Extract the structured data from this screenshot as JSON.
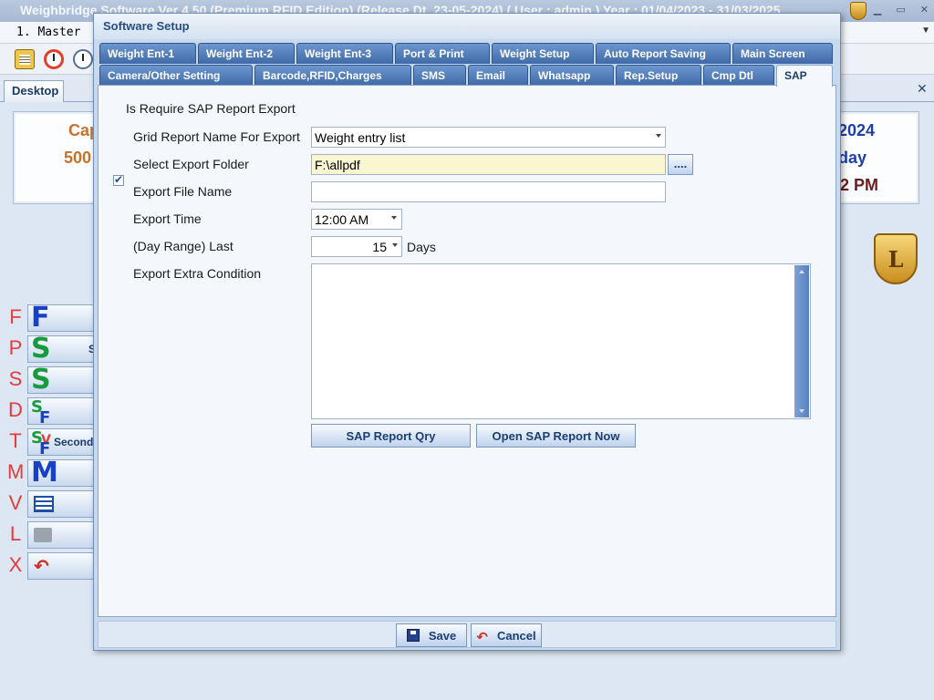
{
  "app": {
    "title": "Weighbridge Software Ver 4.50 (Premium RFID Edition) (Release Dt. 23-05-2024)  ( User : admin ) Year : 01/04/2023 - 31/03/2025",
    "window_controls": [
      "minimize",
      "restore",
      "close"
    ],
    "menu": {
      "first_item": "1. Master"
    },
    "toolbar": {
      "icons": [
        "notes-icon",
        "alarm-clock-icon",
        "clock-icon"
      ]
    }
  },
  "desktop": {
    "tab_label": "Desktop",
    "left_info_lines": [
      "Cap",
      "500"
    ],
    "right_info_lines": [
      "2024",
      "day",
      "2 PM"
    ],
    "badge_letter": "L",
    "shortcuts": [
      {
        "key": "F",
        "glyph": "F",
        "caption": "",
        "color": "#1740c4"
      },
      {
        "key": "P",
        "glyph": "S",
        "caption": "S",
        "color": "#1a9a3e"
      },
      {
        "key": "S",
        "glyph": "S",
        "caption": "",
        "color": "#1a9a3e"
      },
      {
        "key": "D",
        "glyph": "S",
        "caption": "",
        "color": "#1a9a3e"
      },
      {
        "key": "T",
        "glyph": "S",
        "caption": "Second",
        "color": "#1a9a3e"
      },
      {
        "key": "M",
        "glyph": "M",
        "caption": "",
        "color": "#1740c4"
      },
      {
        "key": "V",
        "glyph": "",
        "caption": "",
        "color": "#1d4fa6"
      },
      {
        "key": "L",
        "glyph": "",
        "caption": "",
        "color": "#8d96a3"
      },
      {
        "key": "X",
        "glyph": "",
        "caption": "",
        "color": "#cf2e22"
      }
    ]
  },
  "dialog": {
    "title": "Software Setup",
    "tabs_row1": [
      "Weight Ent-1",
      "Weight Ent-2",
      "Weight Ent-3",
      "Port & Print",
      "Weight Setup",
      "Auto Report Saving",
      "Main Screen"
    ],
    "tabs_row2": [
      "Camera/Other Setting",
      "Barcode,RFID,Charges",
      "SMS",
      "Email",
      "Whatsapp",
      "Rep.Setup",
      "Cmp Dtl",
      "SAP"
    ],
    "active_tab": "SAP",
    "sap": {
      "require_export_label": "Is Require SAP Report Export",
      "require_export_checked": true,
      "grid_report_label": "Grid Report Name For Export",
      "grid_report_value": "Weight entry list",
      "export_folder_label": "Select Export Folder",
      "export_folder_value": "F:\\allpdf",
      "browse_label": "....",
      "file_name_label": "Export File Name",
      "file_name_value": "",
      "export_time_label": "Export Time",
      "export_time_value": "12:00 AM",
      "day_range_label": "(Day Range) Last",
      "day_range_value": "15",
      "day_range_unit": "Days",
      "extra_condition_label": "Export Extra Condition",
      "extra_condition_value": "",
      "report_qry_label": "SAP Report Qry",
      "open_report_label": "Open SAP Report Now"
    },
    "footer": {
      "save_label": "Save",
      "cancel_label": "Cancel"
    }
  }
}
